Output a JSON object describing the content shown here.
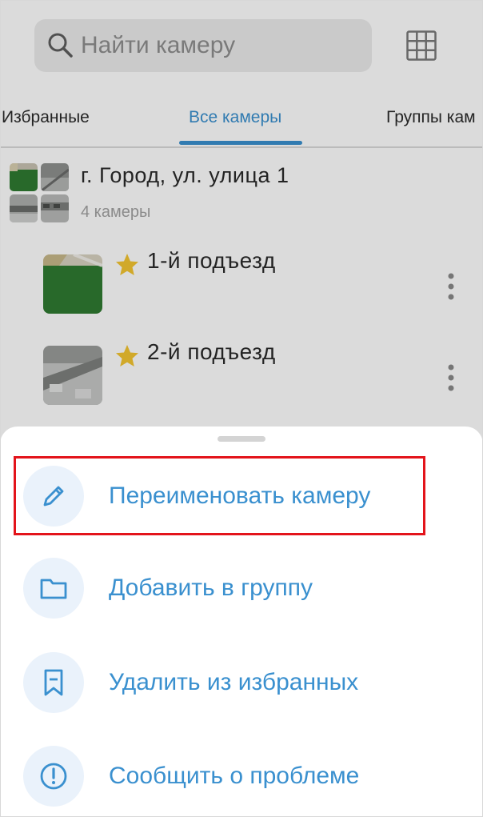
{
  "search": {
    "placeholder": "Найти камеру"
  },
  "tabs": [
    {
      "label": "Избранные",
      "active": false
    },
    {
      "label": "Все камеры",
      "active": true
    },
    {
      "label": "Группы кам",
      "active": false
    }
  ],
  "group": {
    "title": "г. Город, ул. улица 1",
    "subtitle": "4 камеры"
  },
  "cameras": [
    {
      "name": "1-й подъезд",
      "favorite": true
    },
    {
      "name": "2-й подъезд",
      "favorite": true
    }
  ],
  "menu": {
    "items": [
      {
        "label": "Переименовать камеру",
        "icon": "pencil-icon"
      },
      {
        "label": "Добавить в группу",
        "icon": "folder-icon"
      },
      {
        "label": "Удалить из избранных",
        "icon": "bookmark-icon"
      },
      {
        "label": "Сообщить о проблеме",
        "icon": "alert-icon"
      }
    ]
  },
  "colors": {
    "accent": "#3a90cf",
    "star": "#f4c531",
    "highlight": "#e3141b",
    "icon_circle": "#eaf2fb"
  }
}
